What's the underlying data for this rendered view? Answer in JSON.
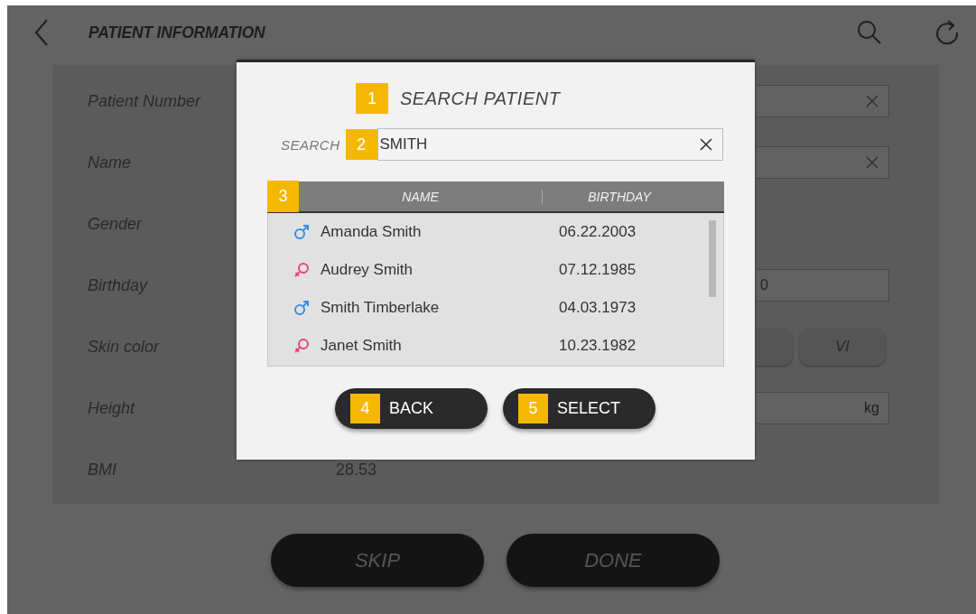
{
  "header": {
    "title": "PATIENT INFORMATION"
  },
  "form": {
    "fields": [
      {
        "label": "Patient Number",
        "kind": "clearable"
      },
      {
        "label": "Name",
        "kind": "clearable"
      },
      {
        "label": "Gender",
        "kind": "empty"
      },
      {
        "label": "Birthday",
        "kind": "placeholder",
        "placeholder": "0"
      },
      {
        "label": "Skin color",
        "kind": "choices",
        "options": [
          "VI"
        ]
      },
      {
        "label": "Height",
        "kind": "unit",
        "unit": "kg"
      },
      {
        "label": "BMI",
        "kind": "value",
        "value": "28.53"
      }
    ]
  },
  "actions": [
    "SKIP",
    "DONE"
  ],
  "dialog": {
    "marker": "1",
    "title": "SEARCH PATIENT",
    "search": {
      "label": "SEARCH",
      "marker": "2",
      "value": "SMITH"
    },
    "table": {
      "marker": "3",
      "columns": [
        "NAME",
        "BIRTHDAY"
      ],
      "rows": [
        {
          "kind": "male",
          "name": "Amanda Smith",
          "birthday": "06.22.2003"
        },
        {
          "kind": "female",
          "name": "Audrey Smith",
          "birthday": "07.12.1985"
        },
        {
          "kind": "male",
          "name": "Smith Timberlake",
          "birthday": "04.03.1973"
        },
        {
          "kind": "female",
          "name": "Janet Smith",
          "birthday": "10.23.1982"
        }
      ]
    },
    "buttons": [
      {
        "marker": "4",
        "label": "BACK"
      },
      {
        "marker": "5",
        "label": "SELECT"
      }
    ]
  }
}
